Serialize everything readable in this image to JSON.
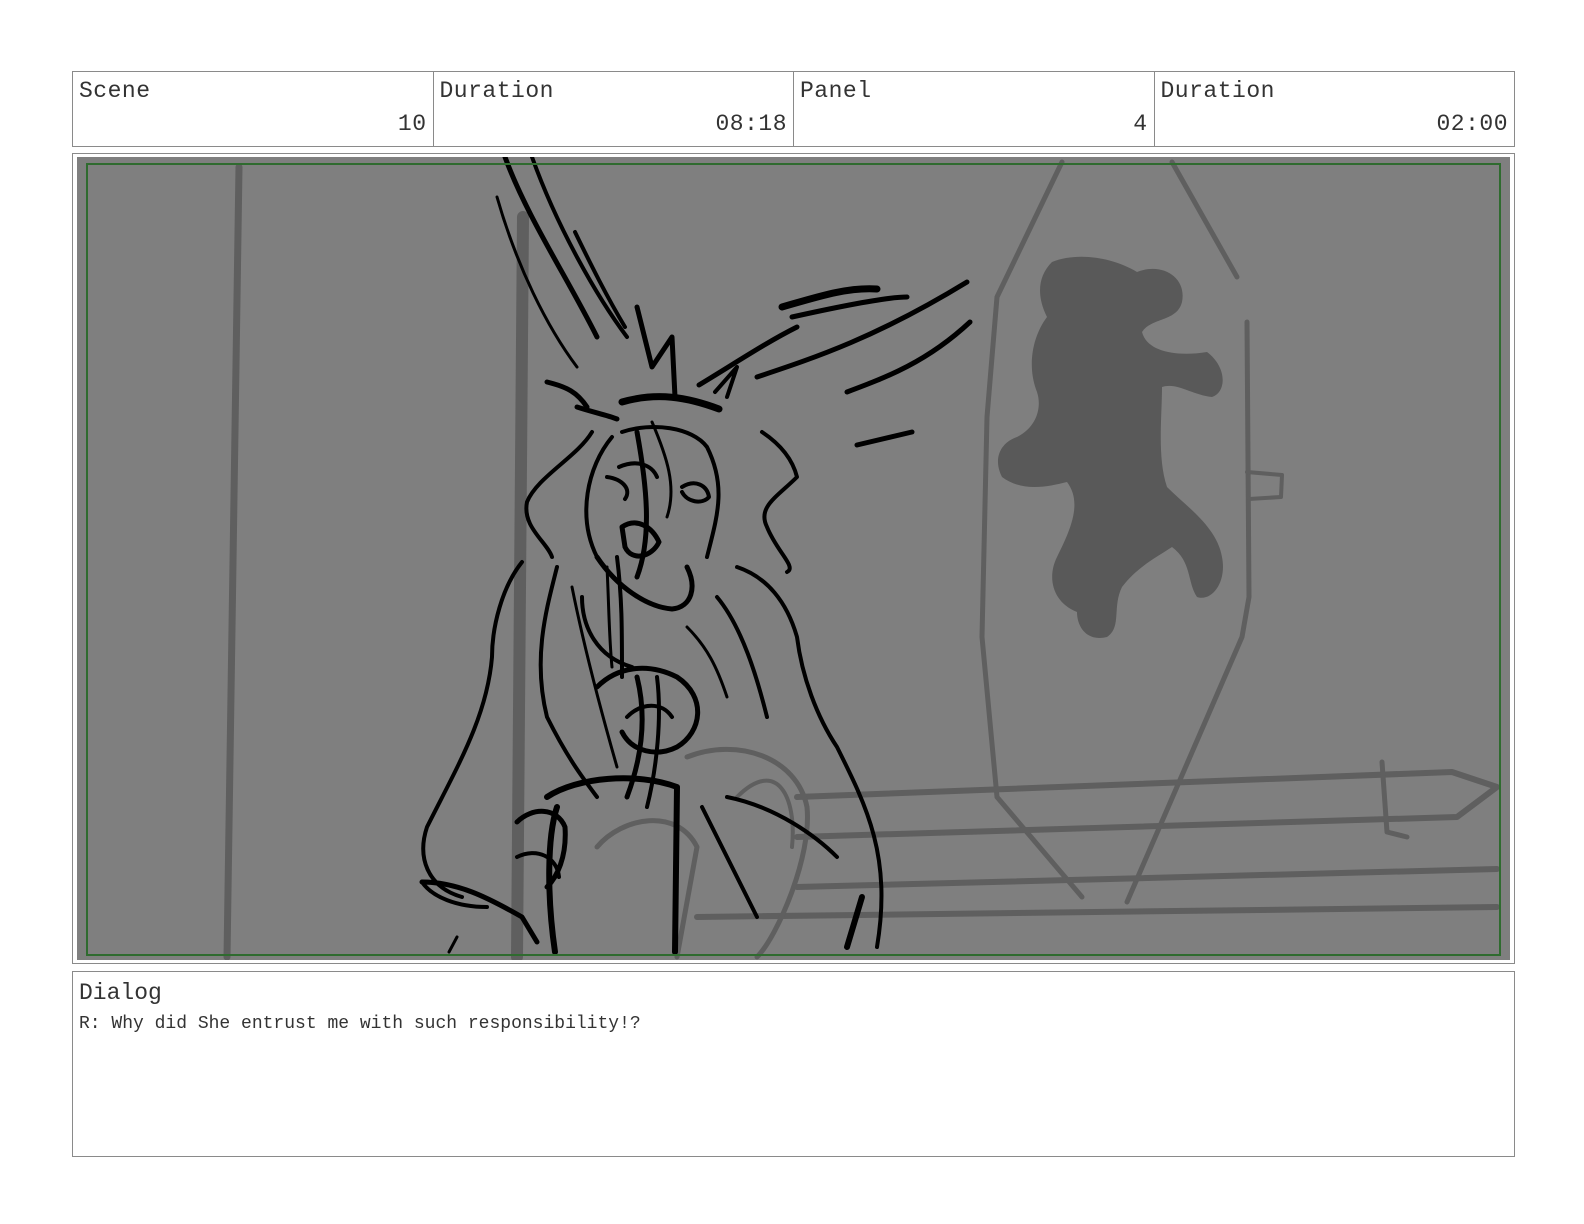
{
  "header": {
    "scene_label": "Scene",
    "scene_value": "10",
    "scene_duration_label": "Duration",
    "scene_duration_value": "08:18",
    "panel_label": "Panel",
    "panel_value": "4",
    "panel_duration_label": "Duration",
    "panel_duration_value": "02:00"
  },
  "panel": {
    "background_color": "#7f7f7f",
    "safe_frame_color": "#2f6b2f",
    "sketch_color": "#000000",
    "background_sketch_color": "#5f5f5f"
  },
  "dialog": {
    "label": "Dialog",
    "text": "R: Why did She entrust me with such responsibility!?"
  }
}
